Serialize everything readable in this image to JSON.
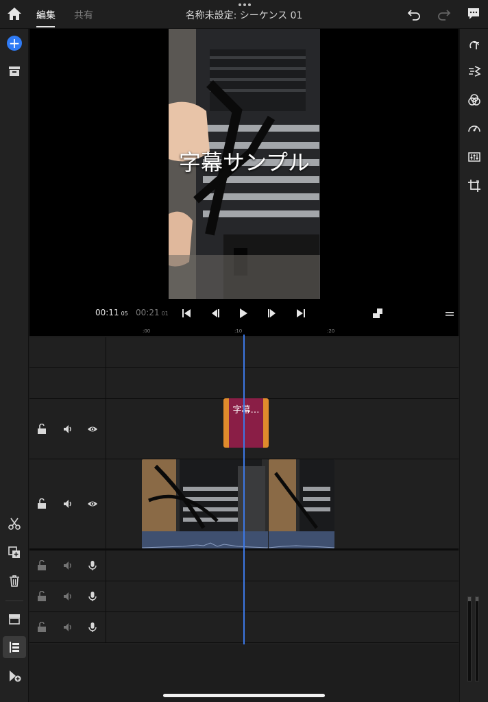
{
  "header": {
    "tabs": [
      {
        "label": "編集",
        "active": true
      },
      {
        "label": "共有",
        "active": false
      }
    ],
    "title": "名称未設定: シーケンス 01"
  },
  "viewer": {
    "caption": "字幕サンプル"
  },
  "transport": {
    "current_time": "00:11",
    "current_frames": "05",
    "total_time": "00:21",
    "total_frames": "01"
  },
  "ruler": {
    "labels": [
      ":00",
      ":10",
      ":20"
    ]
  },
  "timeline": {
    "title_clip_label": "字幕…"
  },
  "colors": {
    "accent_blue": "#2f7bf5",
    "playhead": "#3c78e6",
    "title_clip_outer": "#e08b2c",
    "title_clip_inner": "#8a1e46",
    "audio_wave": "#3f5070"
  }
}
